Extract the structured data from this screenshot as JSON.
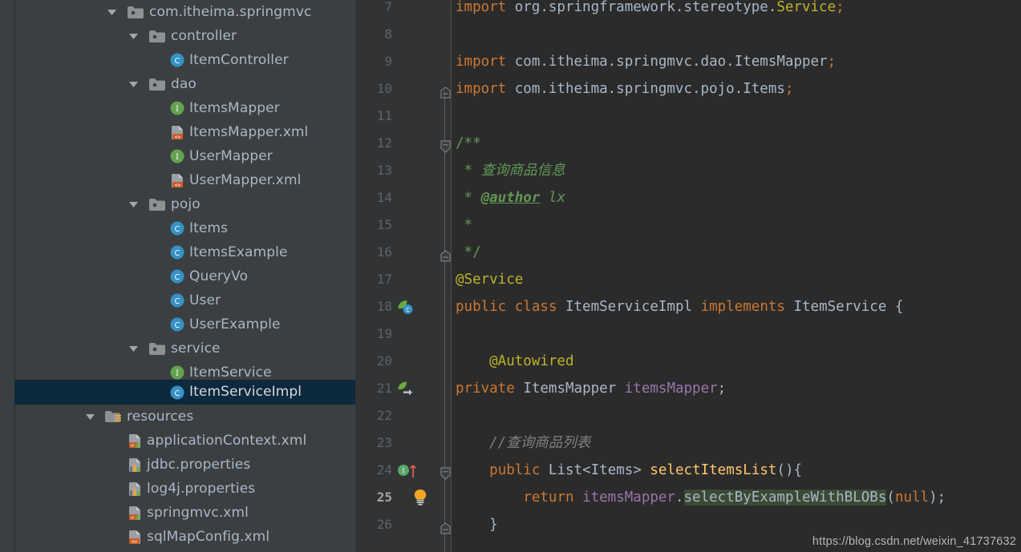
{
  "colors": {
    "tree_bg": "#3c3f41",
    "editor_bg": "#2b2b2b",
    "gutter_bg": "#313335",
    "selection_bg": "#0d293e",
    "text": "#a9b7c6",
    "keyword": "#cc7832",
    "annotation": "#bbb529",
    "comment": "#629755",
    "line_comment": "#808080",
    "field": "#9876aa",
    "method": "#ffc66d",
    "usage_highlight": "#3a4a35",
    "line_number": "#606366",
    "class_icon": "#3592c4",
    "interface_icon": "#62a350",
    "xml_icon": "#cc5c28",
    "properties_icon": "#f0a732"
  },
  "project_tree": {
    "items": [
      {
        "label": "com.itheima.springmvc",
        "icon": "package-folder-icon",
        "twisty": "expanded",
        "indent": 0,
        "selected": false
      },
      {
        "label": "controller",
        "icon": "package-folder-icon",
        "twisty": "expanded",
        "indent": 1,
        "selected": false
      },
      {
        "label": "ItemController",
        "icon": "java-class-icon",
        "twisty": "none",
        "indent": 2,
        "selected": false
      },
      {
        "label": "dao",
        "icon": "package-folder-icon",
        "twisty": "expanded",
        "indent": 1,
        "selected": false
      },
      {
        "label": "ItemsMapper",
        "icon": "java-interface-icon",
        "twisty": "none",
        "indent": 2,
        "selected": false
      },
      {
        "label": "ItemsMapper.xml",
        "icon": "xml-file-icon",
        "twisty": "none",
        "indent": 2,
        "selected": false
      },
      {
        "label": "UserMapper",
        "icon": "java-interface-icon",
        "twisty": "none",
        "indent": 2,
        "selected": false
      },
      {
        "label": "UserMapper.xml",
        "icon": "xml-file-icon",
        "twisty": "none",
        "indent": 2,
        "selected": false
      },
      {
        "label": "pojo",
        "icon": "package-folder-icon",
        "twisty": "expanded",
        "indent": 1,
        "selected": false
      },
      {
        "label": "Items",
        "icon": "java-class-icon",
        "twisty": "none",
        "indent": 2,
        "selected": false
      },
      {
        "label": "ItemsExample",
        "icon": "java-class-icon",
        "twisty": "none",
        "indent": 2,
        "selected": false
      },
      {
        "label": "QueryVo",
        "icon": "java-class-icon",
        "twisty": "none",
        "indent": 2,
        "selected": false
      },
      {
        "label": "User",
        "icon": "java-class-icon",
        "twisty": "none",
        "indent": 2,
        "selected": false
      },
      {
        "label": "UserExample",
        "icon": "java-class-icon",
        "twisty": "none",
        "indent": 2,
        "selected": false
      },
      {
        "label": "service",
        "icon": "package-folder-icon",
        "twisty": "expanded",
        "indent": 1,
        "selected": false
      },
      {
        "label": "ItemService",
        "icon": "java-interface-icon",
        "twisty": "none",
        "indent": 2,
        "selected": false
      },
      {
        "label": "ItemServiceImpl",
        "icon": "java-class-icon",
        "twisty": "none",
        "indent": 2,
        "selected": true
      },
      {
        "label": "resources",
        "icon": "resources-folder-icon",
        "twisty": "expanded",
        "indent": -1,
        "selected": false
      },
      {
        "label": "applicationContext.xml",
        "icon": "spring-xml-icon",
        "twisty": "none",
        "indent": 0,
        "selected": false
      },
      {
        "label": "jdbc.properties",
        "icon": "properties-file-icon",
        "twisty": "none",
        "indent": 0,
        "selected": false
      },
      {
        "label": "log4j.properties",
        "icon": "properties-file-icon",
        "twisty": "none",
        "indent": 0,
        "selected": false
      },
      {
        "label": "springmvc.xml",
        "icon": "spring-xml-icon",
        "twisty": "none",
        "indent": 0,
        "selected": false
      },
      {
        "label": "sqlMapConfig.xml",
        "icon": "xml-file-icon",
        "twisty": "none",
        "indent": 0,
        "selected": false
      }
    ]
  },
  "editor": {
    "lines": [
      {
        "num": "7",
        "gutter_icon": "none",
        "current": false,
        "text": "import org.springframework.stereotype.Service;"
      },
      {
        "num": "8",
        "gutter_icon": "none",
        "current": false,
        "text": ""
      },
      {
        "num": "9",
        "gutter_icon": "none",
        "current": false,
        "text": "import com.itheima.springmvc.dao.ItemsMapper;"
      },
      {
        "num": "10",
        "gutter_icon": "none",
        "current": false,
        "text": "import com.itheima.springmvc.pojo.Items;"
      },
      {
        "num": "11",
        "gutter_icon": "none",
        "current": false,
        "text": ""
      },
      {
        "num": "12",
        "gutter_icon": "none",
        "current": false,
        "text": "/**"
      },
      {
        "num": "13",
        "gutter_icon": "none",
        "current": false,
        "text": " * 查询商品信息"
      },
      {
        "num": "14",
        "gutter_icon": "none",
        "current": false,
        "text": " * @author lx"
      },
      {
        "num": "15",
        "gutter_icon": "none",
        "current": false,
        "text": " *"
      },
      {
        "num": "16",
        "gutter_icon": "none",
        "current": false,
        "text": " */"
      },
      {
        "num": "17",
        "gutter_icon": "none",
        "current": false,
        "text": "@Service"
      },
      {
        "num": "18",
        "gutter_icon": "spring-bean-class-icon",
        "current": false,
        "text": "public class ItemServiceImpl implements ItemService {"
      },
      {
        "num": "19",
        "gutter_icon": "none",
        "current": false,
        "text": ""
      },
      {
        "num": "20",
        "gutter_icon": "none",
        "current": false,
        "text": "    @Autowired"
      },
      {
        "num": "21",
        "gutter_icon": "spring-autowired-icon",
        "current": false,
        "text": "    private ItemsMapper itemsMapper;"
      },
      {
        "num": "22",
        "gutter_icon": "none",
        "current": false,
        "text": ""
      },
      {
        "num": "23",
        "gutter_icon": "none",
        "current": false,
        "text": "    //查询商品列表"
      },
      {
        "num": "24",
        "gutter_icon": "implementing-method-icon",
        "current": false,
        "text": "    public List<Items> selectItemsList(){"
      },
      {
        "num": "25",
        "gutter_icon": "intention-bulb-icon",
        "current": true,
        "text": "        return itemsMapper.selectByExampleWithBLOBs(null);"
      },
      {
        "num": "26",
        "gutter_icon": "none",
        "current": false,
        "text": "    }"
      }
    ]
  },
  "watermark": {
    "url": "https://blog.csdn.net/weixin_41737632"
  }
}
